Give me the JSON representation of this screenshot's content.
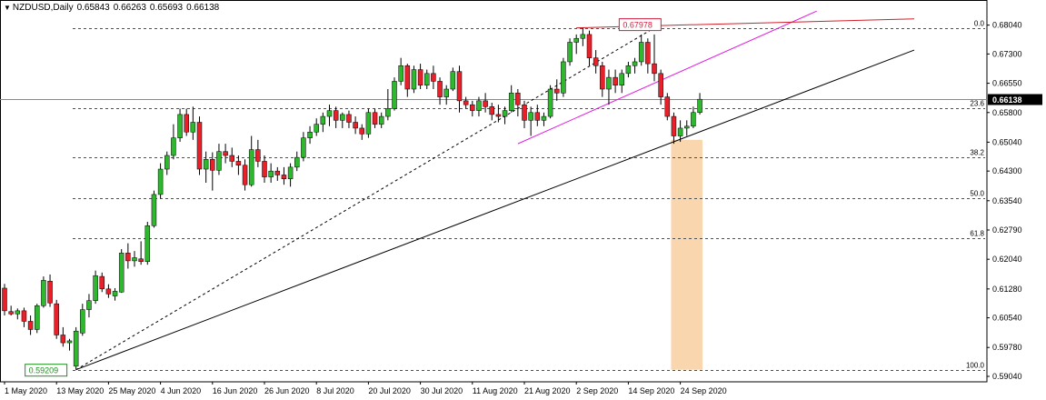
{
  "header": {
    "symbol": "NZDUSD,Daily",
    "open": "0.65843",
    "high": "0.66263",
    "low": "0.65693",
    "close": "0.66138"
  },
  "colors": {
    "bull": "#2eb82e",
    "bear": "#e8202a",
    "grid": "#505050",
    "trend_black": "#000000",
    "trend_magenta": "#e01ee0",
    "trend_red": "#d0212a",
    "price_line": "#7a8ca3",
    "highlight": "#f9d6ae",
    "low_label": "#1f8f1f",
    "high_label": "#d02040"
  },
  "chart_data": {
    "type": "candlestick",
    "ylim": [
      0.589,
      0.6845
    ],
    "y_ticks": [
      "0.68040",
      "0.67300",
      "0.66550",
      "0.65800",
      "0.65040",
      "0.64300",
      "0.63540",
      "0.62790",
      "0.62040",
      "0.61280",
      "0.60540",
      "0.59780",
      "0.59040"
    ],
    "x_ticks": [
      {
        "label": "1 May 2020",
        "i": 0
      },
      {
        "label": "13 May 2020",
        "i": 8
      },
      {
        "label": "25 May 2020",
        "i": 16
      },
      {
        "label": "4 Jun 2020",
        "i": 24
      },
      {
        "label": "16 Jun 2020",
        "i": 32
      },
      {
        "label": "26 Jun 2020",
        "i": 40
      },
      {
        "label": "8 Jul 2020",
        "i": 48
      },
      {
        "label": "20 Jul 2020",
        "i": 56
      },
      {
        "label": "30 Jul 2020",
        "i": 64
      },
      {
        "label": "11 Aug 2020",
        "i": 72
      },
      {
        "label": "21 Aug 2020",
        "i": 80
      },
      {
        "label": "2 Sep 2020",
        "i": 88
      },
      {
        "label": "14 Sep 2020",
        "i": 96
      },
      {
        "label": "24 Sep 2020",
        "i": 104
      }
    ],
    "candles": [
      [
        0.613,
        0.6141,
        0.606,
        0.6072
      ],
      [
        0.607,
        0.6085,
        0.606,
        0.6064
      ],
      [
        0.6064,
        0.6078,
        0.605,
        0.6072
      ],
      [
        0.6072,
        0.608,
        0.603,
        0.6045
      ],
      [
        0.6045,
        0.606,
        0.601,
        0.6024
      ],
      [
        0.6024,
        0.609,
        0.6015,
        0.6085
      ],
      [
        0.6085,
        0.616,
        0.608,
        0.615
      ],
      [
        0.6148,
        0.6165,
        0.6082,
        0.6092
      ],
      [
        0.609,
        0.61,
        0.6,
        0.601
      ],
      [
        0.601,
        0.603,
        0.598,
        0.599
      ],
      [
        0.599,
        0.6,
        0.597,
        0.5995
      ],
      [
        0.593,
        0.603,
        0.5921,
        0.602
      ],
      [
        0.6015,
        0.609,
        0.6008,
        0.6075
      ],
      [
        0.6075,
        0.6115,
        0.6055,
        0.6098
      ],
      [
        0.6098,
        0.6175,
        0.609,
        0.6162
      ],
      [
        0.616,
        0.617,
        0.612,
        0.6128
      ],
      [
        0.6128,
        0.614,
        0.6105,
        0.6115
      ],
      [
        0.611,
        0.613,
        0.6098,
        0.6122
      ],
      [
        0.612,
        0.623,
        0.6118,
        0.622
      ],
      [
        0.622,
        0.6245,
        0.618,
        0.62
      ],
      [
        0.62,
        0.6225,
        0.6185,
        0.6208
      ],
      [
        0.6205,
        0.625,
        0.619,
        0.6198
      ],
      [
        0.6198,
        0.63,
        0.619,
        0.629
      ],
      [
        0.629,
        0.638,
        0.6285,
        0.637
      ],
      [
        0.637,
        0.645,
        0.636,
        0.6435
      ],
      [
        0.6435,
        0.648,
        0.642,
        0.647
      ],
      [
        0.647,
        0.655,
        0.646,
        0.6515
      ],
      [
        0.6515,
        0.659,
        0.6505,
        0.6575
      ],
      [
        0.6575,
        0.659,
        0.652,
        0.653
      ],
      [
        0.653,
        0.6595,
        0.651,
        0.6555
      ],
      [
        0.6555,
        0.657,
        0.642,
        0.6435
      ],
      [
        0.6435,
        0.648,
        0.64,
        0.646
      ],
      [
        0.646,
        0.6478,
        0.638,
        0.6432
      ],
      [
        0.6432,
        0.65,
        0.642,
        0.648
      ],
      [
        0.648,
        0.65,
        0.645,
        0.647
      ],
      [
        0.647,
        0.649,
        0.644,
        0.6455
      ],
      [
        0.6455,
        0.647,
        0.642,
        0.6445
      ],
      [
        0.6445,
        0.646,
        0.638,
        0.6395
      ],
      [
        0.6395,
        0.652,
        0.639,
        0.6485
      ],
      [
        0.6485,
        0.651,
        0.644,
        0.6455
      ],
      [
        0.6455,
        0.647,
        0.64,
        0.6415
      ],
      [
        0.6415,
        0.645,
        0.64,
        0.643
      ],
      [
        0.643,
        0.644,
        0.6405,
        0.642
      ],
      [
        0.642,
        0.644,
        0.6395,
        0.641
      ],
      [
        0.641,
        0.645,
        0.639,
        0.644
      ],
      [
        0.644,
        0.648,
        0.643,
        0.6465
      ],
      [
        0.6465,
        0.653,
        0.6455,
        0.6515
      ],
      [
        0.6515,
        0.6545,
        0.65,
        0.653
      ],
      [
        0.653,
        0.6565,
        0.652,
        0.655
      ],
      [
        0.655,
        0.658,
        0.653,
        0.657
      ],
      [
        0.657,
        0.66,
        0.6545,
        0.6585
      ],
      [
        0.6585,
        0.6595,
        0.654,
        0.656
      ],
      [
        0.656,
        0.658,
        0.654,
        0.6575
      ],
      [
        0.6575,
        0.6585,
        0.654,
        0.6555
      ],
      [
        0.6555,
        0.657,
        0.6525,
        0.654
      ],
      [
        0.654,
        0.655,
        0.651,
        0.6525
      ],
      [
        0.6525,
        0.659,
        0.6515,
        0.658
      ],
      [
        0.658,
        0.659,
        0.654,
        0.655
      ],
      [
        0.655,
        0.658,
        0.654,
        0.657
      ],
      [
        0.657,
        0.664,
        0.656,
        0.659
      ],
      [
        0.659,
        0.667,
        0.6585,
        0.666
      ],
      [
        0.666,
        0.672,
        0.665,
        0.67
      ],
      [
        0.67,
        0.6705,
        0.662,
        0.664
      ],
      [
        0.664,
        0.67,
        0.663,
        0.669
      ],
      [
        0.669,
        0.6705,
        0.664,
        0.665
      ],
      [
        0.665,
        0.669,
        0.664,
        0.668
      ],
      [
        0.668,
        0.67,
        0.664,
        0.666
      ],
      [
        0.666,
        0.667,
        0.66,
        0.662
      ],
      [
        0.662,
        0.665,
        0.66,
        0.664
      ],
      [
        0.664,
        0.6695,
        0.6635,
        0.6685
      ],
      [
        0.6685,
        0.67,
        0.658,
        0.661
      ],
      [
        0.661,
        0.662,
        0.659,
        0.66
      ],
      [
        0.66,
        0.661,
        0.657,
        0.6585
      ],
      [
        0.6585,
        0.662,
        0.657,
        0.661
      ],
      [
        0.661,
        0.663,
        0.658,
        0.6595
      ],
      [
        0.6595,
        0.6605,
        0.656,
        0.6575
      ],
      [
        0.6575,
        0.66,
        0.6555,
        0.657
      ],
      [
        0.657,
        0.6595,
        0.655,
        0.6585
      ],
      [
        0.6585,
        0.665,
        0.658,
        0.663
      ],
      [
        0.663,
        0.664,
        0.657,
        0.66
      ],
      [
        0.66,
        0.661,
        0.654,
        0.656
      ],
      [
        0.656,
        0.6595,
        0.652,
        0.658
      ],
      [
        0.658,
        0.66,
        0.6545,
        0.656
      ],
      [
        0.656,
        0.658,
        0.6545,
        0.657
      ],
      [
        0.657,
        0.665,
        0.6565,
        0.664
      ],
      [
        0.664,
        0.6665,
        0.661,
        0.663
      ],
      [
        0.663,
        0.672,
        0.662,
        0.671
      ],
      [
        0.671,
        0.677,
        0.67,
        0.676
      ],
      [
        0.676,
        0.678,
        0.673,
        0.677
      ],
      [
        0.677,
        0.6797,
        0.675,
        0.678
      ],
      [
        0.678,
        0.679,
        0.67,
        0.672
      ],
      [
        0.672,
        0.674,
        0.668,
        0.67
      ],
      [
        0.67,
        0.671,
        0.662,
        0.664
      ],
      [
        0.664,
        0.669,
        0.66,
        0.667
      ],
      [
        0.667,
        0.669,
        0.663,
        0.665
      ],
      [
        0.665,
        0.669,
        0.663,
        0.668
      ],
      [
        0.668,
        0.671,
        0.667,
        0.67
      ],
      [
        0.67,
        0.672,
        0.668,
        0.671
      ],
      [
        0.671,
        0.678,
        0.67,
        0.676
      ],
      [
        0.676,
        0.677,
        0.668,
        0.6705
      ],
      [
        0.6705,
        0.678,
        0.666,
        0.668
      ],
      [
        0.668,
        0.669,
        0.66,
        0.662
      ],
      [
        0.662,
        0.663,
        0.656,
        0.657
      ],
      [
        0.657,
        0.658,
        0.65,
        0.652
      ],
      [
        0.652,
        0.656,
        0.6505,
        0.654
      ],
      [
        0.654,
        0.656,
        0.652,
        0.6545
      ],
      [
        0.6545,
        0.6595,
        0.654,
        0.658
      ],
      [
        0.658,
        0.663,
        0.6575,
        0.6614
      ]
    ],
    "levels": [
      {
        "label": "0.0",
        "y": 0.6797
      },
      {
        "label": "23.6",
        "y": 0.6592
      },
      {
        "label": "38.2",
        "y": 0.6466
      },
      {
        "label": "50.0",
        "y": 0.636
      },
      {
        "label": "61.8",
        "y": 0.6259
      },
      {
        "label": "100.0",
        "y": 0.5921
      }
    ],
    "trendlines": [
      {
        "kind": "black",
        "from": [
          11,
          0.5921
        ],
        "to": [
          140,
          0.674
        ]
      },
      {
        "kind": "magenta",
        "from": [
          79,
          0.65
        ],
        "to": [
          125,
          0.684
        ]
      },
      {
        "kind": "red",
        "from": [
          88,
          0.6797
        ],
        "to": [
          140,
          0.682
        ]
      }
    ],
    "dashed_line": {
      "from": [
        11,
        0.5921
      ],
      "to": [
        100,
        0.6797
      ]
    },
    "highlight_zone": {
      "i_from": 103,
      "i_to": 107,
      "y_from": 0.5921,
      "y_to": 0.651
    },
    "current_price": {
      "value": 0.66138,
      "label": "0.66138"
    },
    "annotations": [
      {
        "label": "0.59209",
        "i": 11,
        "y": 0.5921,
        "kind": "low"
      },
      {
        "label": "0.67978",
        "i": 89,
        "y": 0.6797,
        "kind": "high"
      }
    ]
  }
}
